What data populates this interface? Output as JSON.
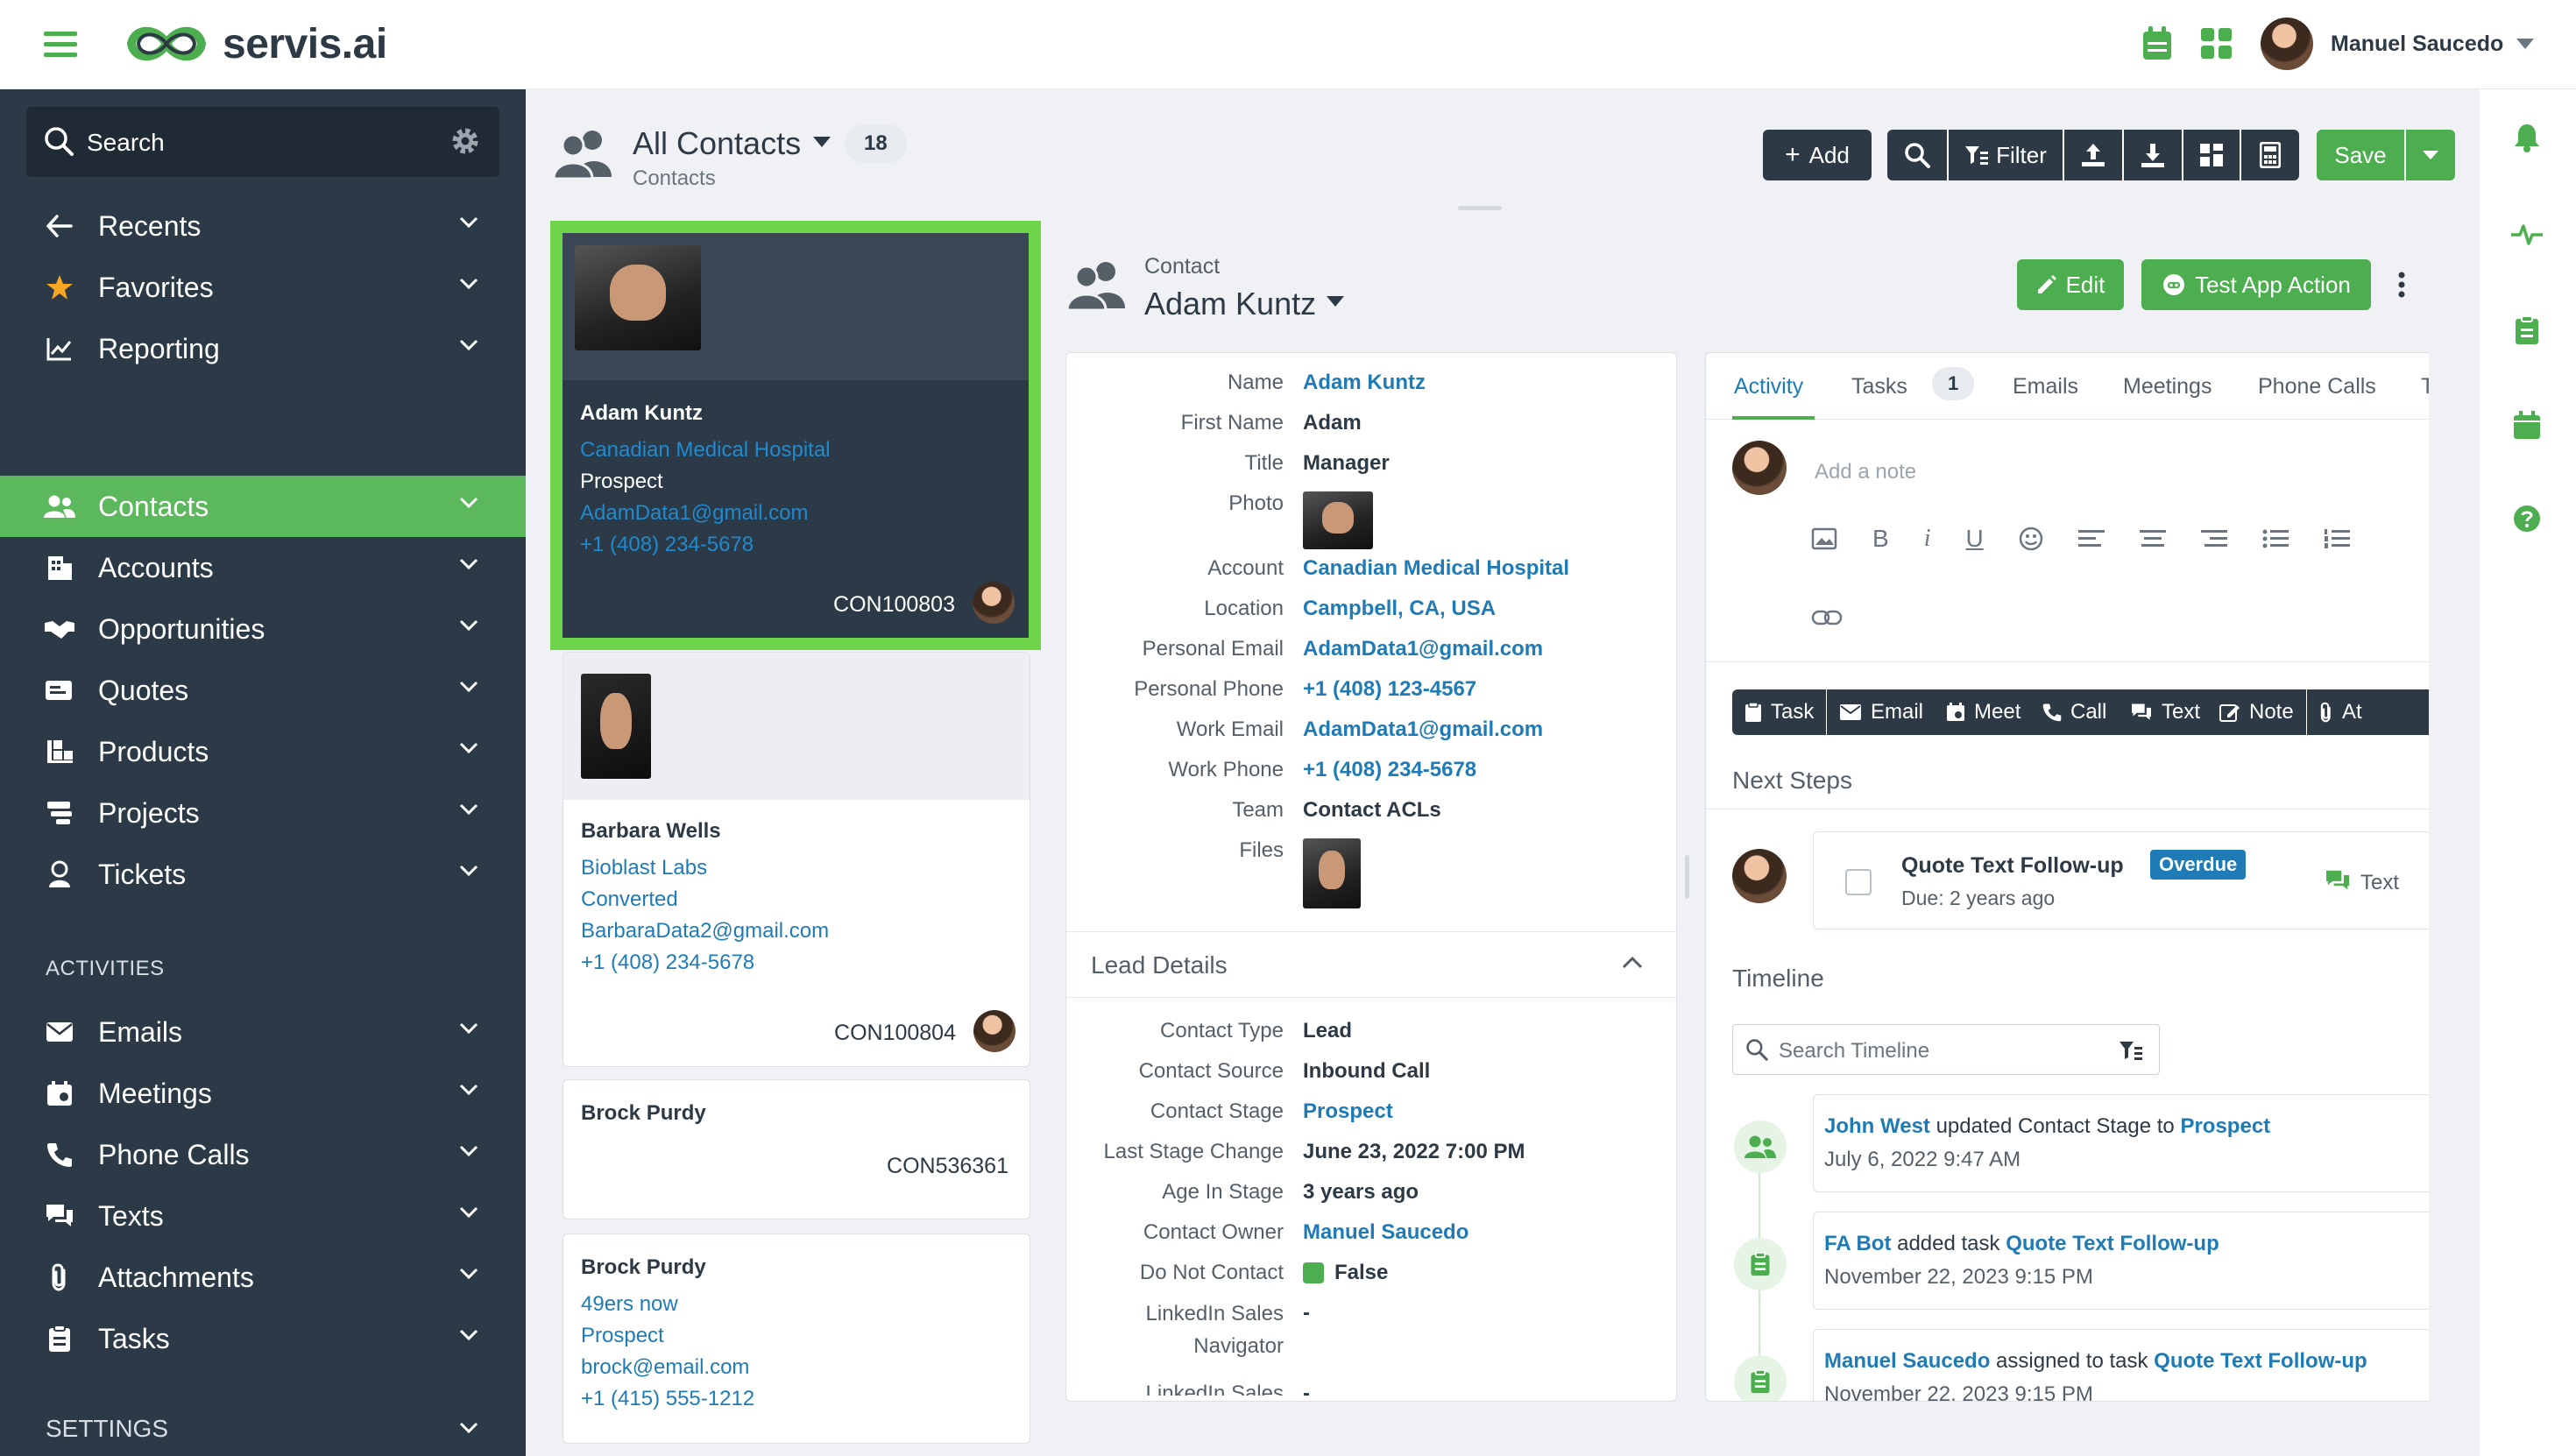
{
  "topbar": {
    "brand": "servis.ai",
    "user_name": "Manuel Saucedo"
  },
  "sidebar": {
    "search_placeholder": "Search",
    "items": [
      {
        "label": "Recents",
        "icon": "arrow-left-icon"
      },
      {
        "label": "Favorites",
        "icon": "star-icon"
      },
      {
        "label": "Reporting",
        "icon": "chart-line-icon"
      },
      {
        "label": "Contacts",
        "icon": "users-icon",
        "active": true
      },
      {
        "label": "Accounts",
        "icon": "building-icon"
      },
      {
        "label": "Opportunities",
        "icon": "handshake-icon"
      },
      {
        "label": "Quotes",
        "icon": "quote-icon"
      },
      {
        "label": "Products",
        "icon": "boxes-icon"
      },
      {
        "label": "Projects",
        "icon": "projects-icon"
      },
      {
        "label": "Tickets",
        "icon": "ticket-icon"
      }
    ],
    "activities_heading": "ACTIVITIES",
    "activity_items": [
      {
        "label": "Emails",
        "icon": "envelope-icon"
      },
      {
        "label": "Meetings",
        "icon": "calendar-icon"
      },
      {
        "label": "Phone Calls",
        "icon": "phone-icon"
      },
      {
        "label": "Texts",
        "icon": "chat-icon"
      },
      {
        "label": "Attachments",
        "icon": "paperclip-icon"
      },
      {
        "label": "Tasks",
        "icon": "clipboard-icon"
      }
    ],
    "settings_heading": "SETTINGS"
  },
  "list_header": {
    "title": "All Contacts",
    "count": "18",
    "subtitle": "Contacts"
  },
  "toolbar": {
    "add_label": "Add",
    "filter_label": "Filter",
    "save_label": "Save"
  },
  "cards": [
    {
      "name": "Adam Kuntz",
      "company": "Canadian Medical Hospital",
      "stage": "Prospect",
      "email": "AdamData1@gmail.com",
      "phone": "+1 (408) 234-5678",
      "id": "CON100803"
    },
    {
      "name": "Barbara Wells",
      "company": "Bioblast Labs",
      "stage": "Converted",
      "email": "BarbaraData2@gmail.com",
      "phone": "+1 (408) 234-5678",
      "id": "CON100804"
    },
    {
      "name": "Brock Purdy",
      "id": "CON536361"
    },
    {
      "name": "Brock Purdy",
      "company": "49ers now",
      "stage": "Prospect",
      "email": "brock@email.com",
      "phone": "+1 (415) 555-1212"
    }
  ],
  "detail": {
    "type_label": "Contact",
    "name": "Adam Kuntz",
    "edit_label": "Edit",
    "test_action_label": "Test App Action",
    "fields": [
      {
        "label": "Name",
        "value": "Adam Kuntz",
        "link": true
      },
      {
        "label": "First Name",
        "value": "Adam"
      },
      {
        "label": "Title",
        "value": "Manager"
      },
      {
        "label": "Photo",
        "value": ""
      },
      {
        "label": "Account",
        "value": "Canadian Medical Hospital",
        "link": true
      },
      {
        "label": "Location",
        "value": "Campbell, CA, USA",
        "link": true
      },
      {
        "label": "Personal Email",
        "value": "AdamData1@gmail.com",
        "link": true
      },
      {
        "label": "Personal Phone",
        "value": "+1 (408) 123-4567",
        "link": true
      },
      {
        "label": "Work Email",
        "value": "AdamData1@gmail.com",
        "link": true
      },
      {
        "label": "Work Phone",
        "value": "+1 (408) 234-5678",
        "link": true
      },
      {
        "label": "Team",
        "value": "Contact ACLs"
      },
      {
        "label": "Files",
        "value": ""
      }
    ],
    "lead_section_title": "Lead Details",
    "lead_fields": [
      {
        "label": "Contact Type",
        "value": "Lead"
      },
      {
        "label": "Contact Source",
        "value": "Inbound Call"
      },
      {
        "label": "Contact Stage",
        "value": "Prospect",
        "link": true
      },
      {
        "label": "Last Stage Change",
        "value": "June 23, 2022 7:00 PM"
      },
      {
        "label": "Age In Stage",
        "value": "3 years ago"
      },
      {
        "label": "Contact Owner",
        "value": "Manuel Saucedo",
        "link": true
      },
      {
        "label": "Do Not Contact",
        "value": "False"
      },
      {
        "label": "LinkedIn Sales Navigator",
        "value": "-"
      },
      {
        "label": "LinkedIn Sales",
        "value": "-"
      }
    ]
  },
  "activity": {
    "tabs": [
      "Activity",
      "Tasks",
      "Emails",
      "Meetings",
      "Phone Calls"
    ],
    "tasks_count": "1",
    "note_placeholder": "Add a note",
    "buttons": [
      "Task",
      "Email",
      "Meet",
      "Call",
      "Text",
      "Note",
      "At"
    ],
    "next_steps_title": "Next Steps",
    "next_step": {
      "title": "Quote Text Follow-up",
      "badge": "Overdue",
      "due": "Due: 2 years ago",
      "type": "Text"
    },
    "timeline_title": "Timeline",
    "timeline_search_placeholder": "Search Timeline",
    "timeline": [
      {
        "actor": "John West",
        "action": "updated Contact Stage to",
        "target": "Prospect",
        "time": "July 6, 2022 9:47 AM"
      },
      {
        "actor": "FA Bot",
        "action": "added task",
        "target": "Quote Text Follow-up",
        "time": "November 22, 2023 9:15 PM"
      },
      {
        "actor": "Manuel Saucedo",
        "action": "assigned to task",
        "target": "Quote Text Follow-up",
        "time": "November 22, 2023 9:15 PM"
      }
    ]
  },
  "colors": {
    "accent_green": "#5cb85c",
    "link_blue": "#1f7bb6",
    "sidebar_bg": "#2c3a47",
    "overdue_badge": "#1f7bb6"
  }
}
